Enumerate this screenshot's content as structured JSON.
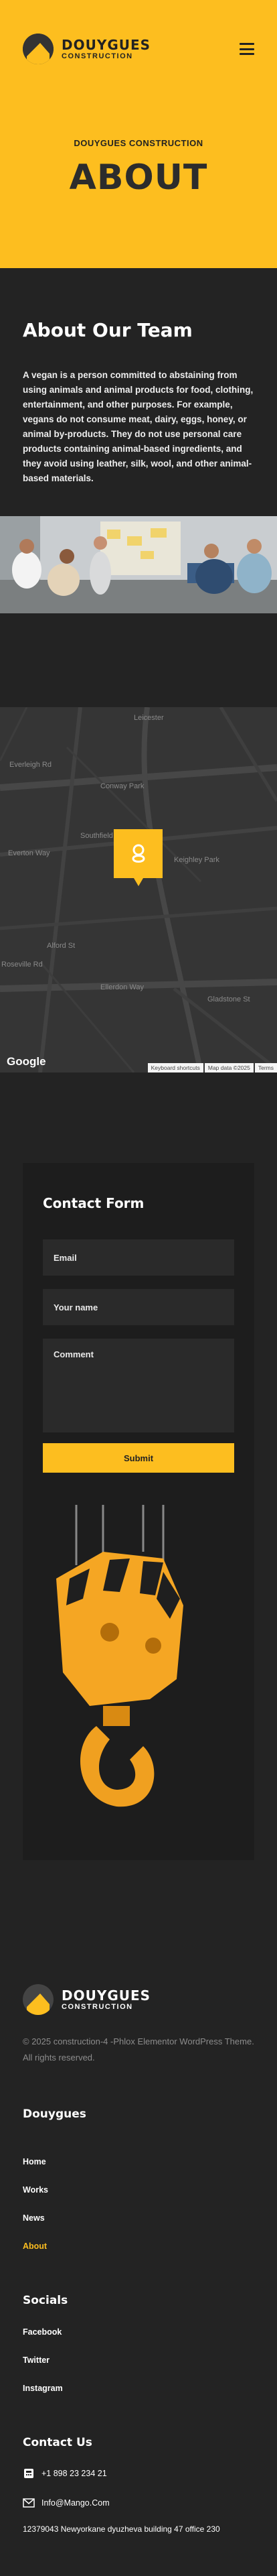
{
  "brand": {
    "name": "DOUYGUES",
    "tagline": "CONSTRUCTION"
  },
  "hero": {
    "subtitle": "DOUYGUES CONSTRUCTION",
    "title": "ABOUT"
  },
  "team": {
    "heading": "About Our Team",
    "body": "A vegan is a person committed to abstaining from using animals and animal products for food, clothing, entertainment, and other purposes. For example, vegans do not consume meat, dairy, eggs, honey, or animal by-products. They do not use personal care products containing animal-based ingredients, and they avoid using leather, silk, wool, and other animal-based materials."
  },
  "map": {
    "labels": [
      "Conway Park",
      "Southfield",
      "Leicester",
      "Keighley Park",
      "Everleigh Rd",
      "Everton Way",
      "Ellerdon Way",
      "Roseville Rd",
      "Gladstone St",
      "Alford St"
    ],
    "google": "Google",
    "attribution": [
      "Keyboard shortcuts",
      "Map data ©2025",
      "Terms"
    ]
  },
  "contact": {
    "heading": "Contact Form",
    "email_placeholder": "Email",
    "name_placeholder": "Your name",
    "comment_placeholder": "Comment",
    "submit_label": "Submit"
  },
  "footer": {
    "brand_name": "DOUYGUES",
    "brand_tagline": "CONSTRUCTION",
    "copyright": "© 2025 construction-4 -Phlox Elementor WordPress Theme. All rights reserved.",
    "menu_heading": "Douygues",
    "menu": [
      "Home",
      "Works",
      "News",
      "About"
    ],
    "socials_heading": "Socials",
    "socials": [
      "Facebook",
      "Twitter",
      "Instagram"
    ],
    "contact_heading": "Contact Us",
    "phone": "+1 898 23 234 21",
    "email": "Info@Mango.Com",
    "address": "12379043 Newyorkane dyuzheva building 47 office 230"
  },
  "colors": {
    "accent": "#FDBE1F",
    "dark": "#232323",
    "card": "#1d1d1d",
    "field": "#2a2a2a"
  }
}
